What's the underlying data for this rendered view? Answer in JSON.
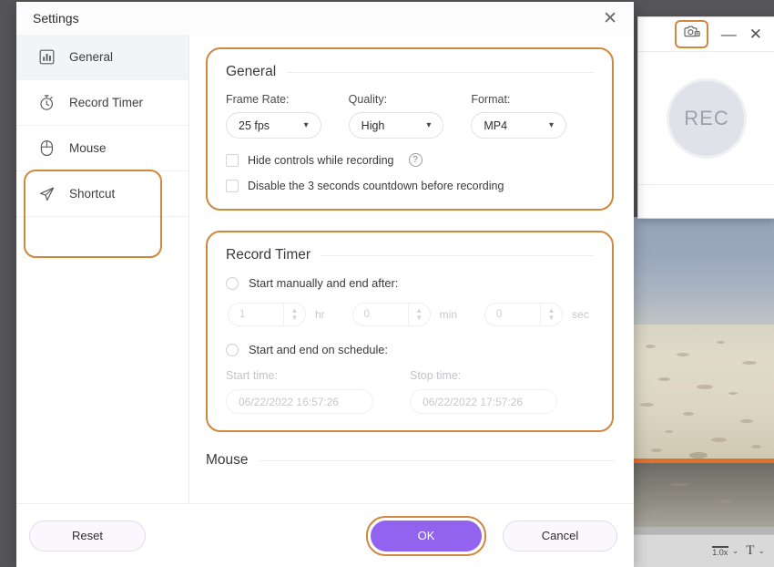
{
  "settings_window": {
    "title": "Settings",
    "close_label": "✕",
    "sidebar": {
      "items": [
        {
          "label": "General",
          "icon": "bar-chart-icon",
          "active": true
        },
        {
          "label": "Record Timer",
          "icon": "stopwatch-icon",
          "active": false
        },
        {
          "label": "Mouse",
          "icon": "mouse-icon",
          "active": false
        },
        {
          "label": "Shortcut",
          "icon": "paper-plane-icon",
          "active": false
        }
      ],
      "highlight_color": "#d0873f"
    },
    "general_section": {
      "title": "General",
      "fields": [
        {
          "label": "Frame Rate:",
          "value": "25 fps"
        },
        {
          "label": "Quality:",
          "value": "High"
        },
        {
          "label": "Format:",
          "value": "MP4"
        }
      ],
      "checkboxes": [
        {
          "label": "Hide controls while recording",
          "checked": false,
          "has_help": true
        },
        {
          "label": "Disable the 3 seconds countdown before recording",
          "checked": false,
          "has_help": false
        }
      ],
      "help_glyph": "?"
    },
    "record_timer_section": {
      "title": "Record Timer",
      "option_manual": "Start manually and end after:",
      "option_schedule": "Start and end on schedule:",
      "duration": {
        "hours": {
          "value": "1",
          "unit": "hr"
        },
        "minutes": {
          "value": "0",
          "unit": "min"
        },
        "seconds": {
          "value": "0",
          "unit": "sec"
        }
      },
      "schedule": {
        "start_label": "Start time:",
        "start_value": "06/22/2022 16:57:26",
        "stop_label": "Stop time:",
        "stop_value": "06/22/2022 17:57:26"
      }
    },
    "mouse_section": {
      "title": "Mouse"
    },
    "footer": {
      "reset_label": "Reset",
      "ok_label": "OK",
      "cancel_label": "Cancel",
      "ok_color": "#9163ee",
      "ok_highlight_color": "#d0873f"
    }
  },
  "recorder_window": {
    "settings_icon": "gear-camera-icon",
    "minimize_label": "—",
    "close_label": "✕",
    "rec_label": "REC",
    "settings_highlight_color": "#d0873f"
  },
  "bottom_toolbar": {
    "speed_value": "1.0x",
    "speed_caret": "⌄",
    "text_tool": "T",
    "text_caret": "⌄"
  }
}
